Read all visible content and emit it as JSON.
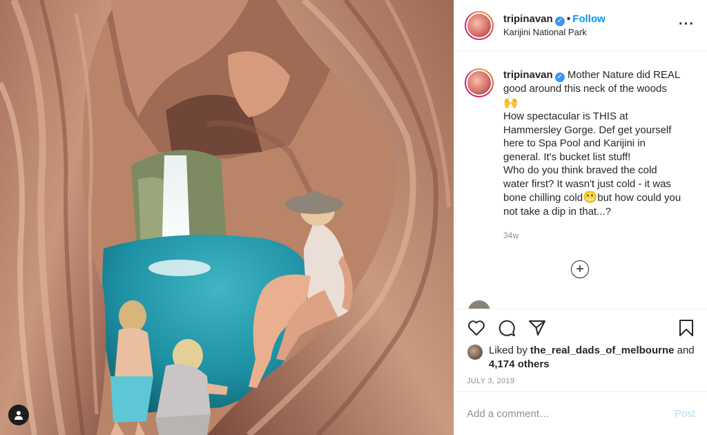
{
  "post": {
    "username": "tripinavan",
    "verified": true,
    "follow_label": "Follow",
    "location": "Karijini National Park",
    "more_icon": "more-options-icon"
  },
  "caption": {
    "username": "tripinavan",
    "lines": [
      "Mother Nature did REAL good around this neck of the woods",
      "🙌",
      "How spectacular is THIS at Hammersley Gorge. Def get yourself here to Spa Pool and Karijini in general. It's bucket list stuff!",
      "Who do you think braved the cold water first? It wasn't just cold - it was bone chilling cold",
      "😬",
      "but how could you not take a dip in that...?"
    ],
    "time_ago": "34w"
  },
  "load_more_icon": "plus-circle-icon",
  "peek_comment": {
    "text": "…"
  },
  "actions": {
    "icons": [
      "heart-icon",
      "comment-icon",
      "share-icon",
      "bookmark-icon"
    ]
  },
  "likes": {
    "prefix": "Liked by",
    "by_user": "the_real_dads_of_melbourne",
    "suffix": "and",
    "others": "4,174 others"
  },
  "date": "JULY 3, 2019",
  "comment_box": {
    "placeholder": "Add a comment…",
    "post_label": "Post"
  },
  "colors": {
    "follow": "#0095f6",
    "verified": "#3897f0",
    "post_disabled": "#b2dffc",
    "pool": "#1d8fa2"
  }
}
